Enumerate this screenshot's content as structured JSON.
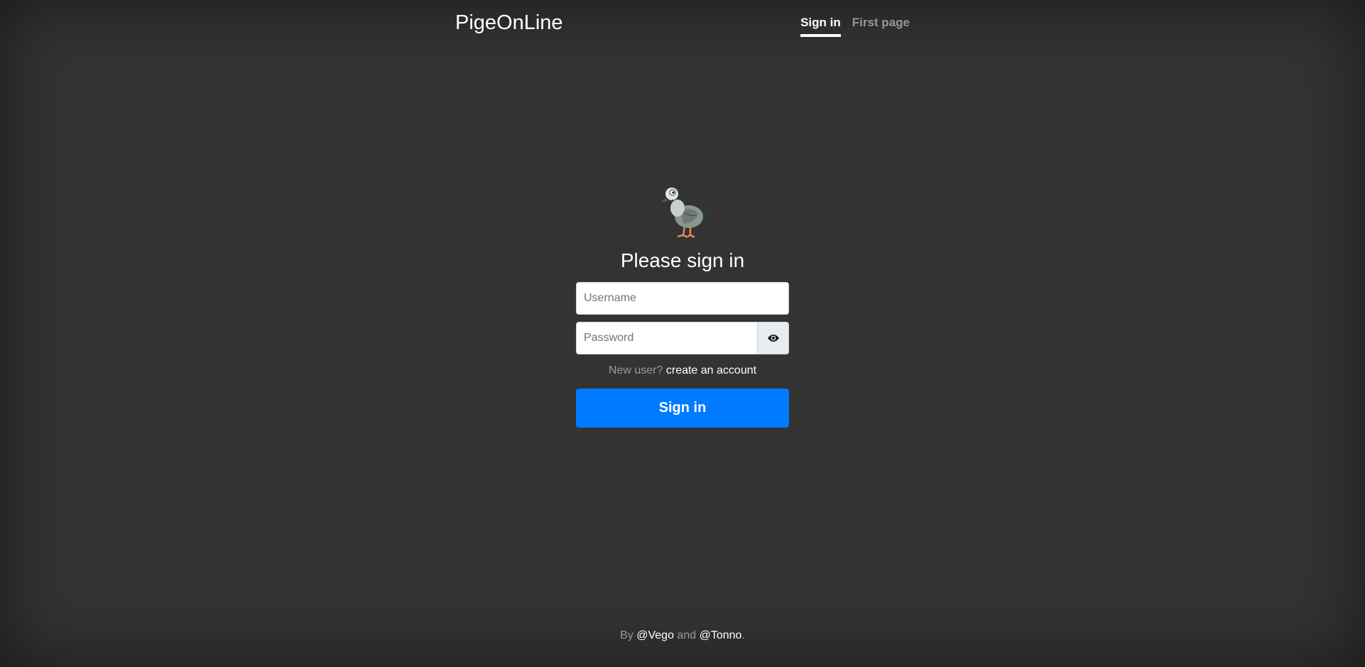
{
  "header": {
    "brand": "PigeOnLine",
    "nav": [
      {
        "label": "Sign in",
        "active": true
      },
      {
        "label": "First page",
        "active": false
      }
    ]
  },
  "form": {
    "logo_icon": "pigeon-logo",
    "heading": "Please sign in",
    "username_placeholder": "Username",
    "username_value": "",
    "password_placeholder": "Password",
    "password_value": "",
    "toggle_icon": "eye-icon",
    "new_user_text": "New user?",
    "create_account_link": "create an account",
    "submit_label": "Sign in"
  },
  "footer": {
    "prefix": "By",
    "author1": "@Vego",
    "conjunction": "and",
    "author2": "@Tonno",
    "suffix": "."
  },
  "colors": {
    "background": "#333333",
    "primary": "#007bff",
    "text": "#ffffff"
  }
}
